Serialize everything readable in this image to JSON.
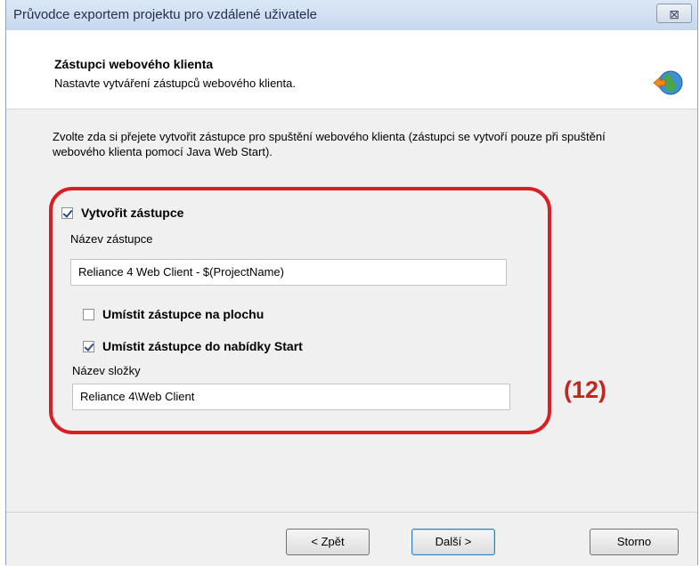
{
  "window": {
    "title": "Průvodce exportem projektu pro vzdálené uživatele",
    "close_label": "⊠"
  },
  "header": {
    "title": "Zástupci webového klienta",
    "subtitle": "Nastavte vytváření zástupců webového klienta.",
    "icon": "globe-arrow-icon"
  },
  "content": {
    "intro": "Zvolte zda si přejete vytvořit zástupce pro spuštění webového klienta (zástupci se vytvoří pouze při spuštění webového klienta pomocí Java Web Start).",
    "create_shortcut": {
      "label": "Vytvořit zástupce",
      "checked": true
    },
    "shortcut_name_label": "Název zástupce",
    "shortcut_name_value": "Reliance 4 Web Client - $(ProjectName)",
    "desktop_shortcut": {
      "label": "Umístit zástupce na plochu",
      "checked": false
    },
    "start_menu_shortcut": {
      "label": "Umístit zástupce do nabídky Start",
      "checked": true
    },
    "folder_name_label": "Název složky",
    "folder_name_value": "Reliance 4\\Web Client"
  },
  "annotation": {
    "label": "(12)",
    "color": "#d91e24"
  },
  "footer": {
    "back_label": "< Zpět",
    "next_label": "Další >",
    "cancel_label": "Storno"
  }
}
